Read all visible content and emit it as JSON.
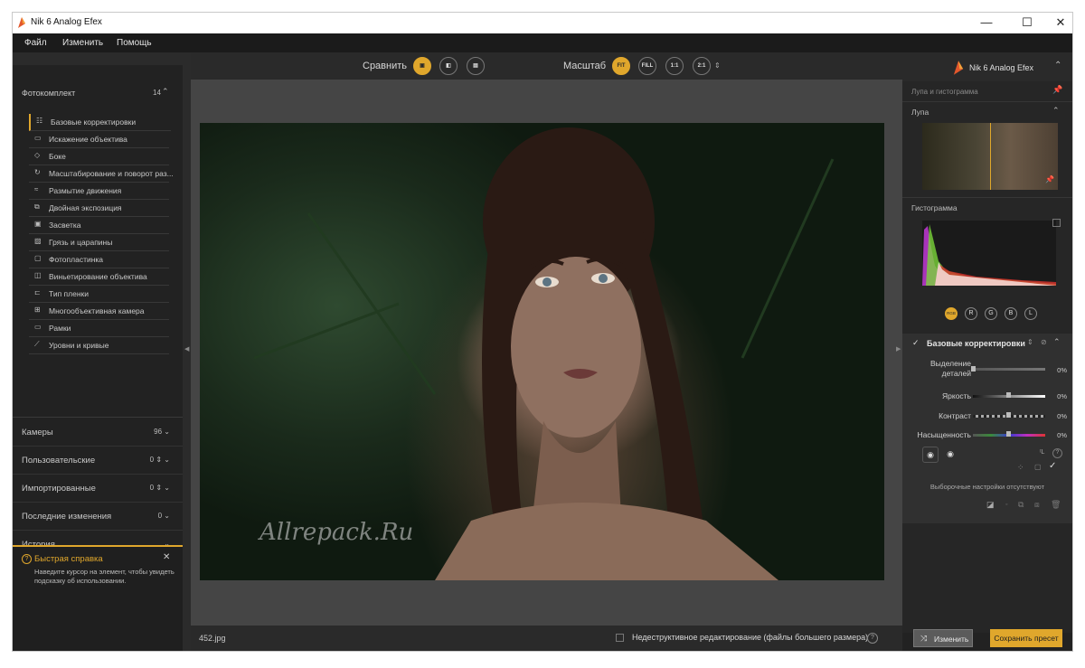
{
  "window": {
    "title": "Nik 6 Analog Efex",
    "minimize": "—",
    "maximize": "☐",
    "close": "✕"
  },
  "menu": [
    "Файл",
    "Изменить",
    "Помощь"
  ],
  "left_panel": {
    "kit": {
      "label": "Фотокомплект",
      "count": "14"
    },
    "items": [
      {
        "label": "Базовые корректировки",
        "icon": "☷",
        "icon_name": "sliders-icon"
      },
      {
        "label": "Искажение объектива",
        "icon": "▭",
        "icon_name": "lens-distortion-icon"
      },
      {
        "label": "Боке",
        "icon": "◇",
        "icon_name": "bokeh-icon"
      },
      {
        "label": "Масштабирование и поворот раз...",
        "icon": "↻",
        "icon_name": "rotate-icon"
      },
      {
        "label": "Размытие движения",
        "icon": "≈",
        "icon_name": "motion-blur-icon"
      },
      {
        "label": "Двойная экспозиция",
        "icon": "⧉",
        "icon_name": "double-exposure-icon"
      },
      {
        "label": "Засветка",
        "icon": "▣",
        "icon_name": "light-leak-icon"
      },
      {
        "label": "Грязь и царапины",
        "icon": "▨",
        "icon_name": "dust-scratches-icon"
      },
      {
        "label": "Фотопластинка",
        "icon": "▢",
        "icon_name": "wet-plate-icon"
      },
      {
        "label": "Виньетирование объектива",
        "icon": "◫",
        "icon_name": "vignette-icon"
      },
      {
        "label": "Тип пленки",
        "icon": "⊏",
        "icon_name": "film-type-icon"
      },
      {
        "label": "Многообъективная камера",
        "icon": "⊞",
        "icon_name": "multi-lens-icon"
      },
      {
        "label": "Рамки",
        "icon": "▭",
        "icon_name": "frames-icon"
      },
      {
        "label": "Уровни и кривые",
        "icon": "⟋",
        "icon_name": "levels-curves-icon"
      }
    ],
    "sections": [
      {
        "label": "Камеры",
        "count": "96"
      },
      {
        "label": "Пользовательские",
        "count": "0"
      },
      {
        "label": "Импортированные",
        "count": "0"
      },
      {
        "label": "Последние изменения",
        "count": "0"
      },
      {
        "label": "История",
        "count": ""
      }
    ],
    "quick_help": {
      "title": "Быстрая справка",
      "text": "Наведите курсор на элемент, чтобы увидеть подсказку об использовании."
    }
  },
  "toolbar": {
    "compare_label": "Сравнить",
    "scale_label": "Масштаб",
    "scale_buttons": [
      "FIT",
      "FILL",
      "1:1",
      "2:1"
    ]
  },
  "image": {
    "watermark": "Allrepack.Ru",
    "filename": "452.jpg",
    "nondestructive": "Недеструктивное редактирование (файлы большего размера)"
  },
  "right_panel": {
    "product": "Nik 6 Analog Efex",
    "loupe_histogram": "Лупа и гистограмма",
    "loupe": "Лупа",
    "histogram": "Гистограмма",
    "hist_buttons": [
      "RGB",
      "R",
      "G",
      "B",
      "L"
    ],
    "basic": {
      "title": "Базовые корректировки",
      "sliders": [
        {
          "label": "Выделение деталей",
          "value": "0%",
          "level": 0
        },
        {
          "label": "Яркость",
          "value": "0%",
          "level": 0.5
        },
        {
          "label": "Контраст",
          "value": "0%",
          "level": 0.5
        },
        {
          "label": "Насыщенность",
          "value": "0%",
          "level": 0.5
        }
      ],
      "no_selective": "Выборочные настройки отсутствуют"
    },
    "change_button": "Изменить",
    "save_preset_button": "Сохранить пресет"
  },
  "colors": {
    "accent": "#e0a72c",
    "panel_bg": "#222222",
    "canvas_bg": "#454545"
  }
}
